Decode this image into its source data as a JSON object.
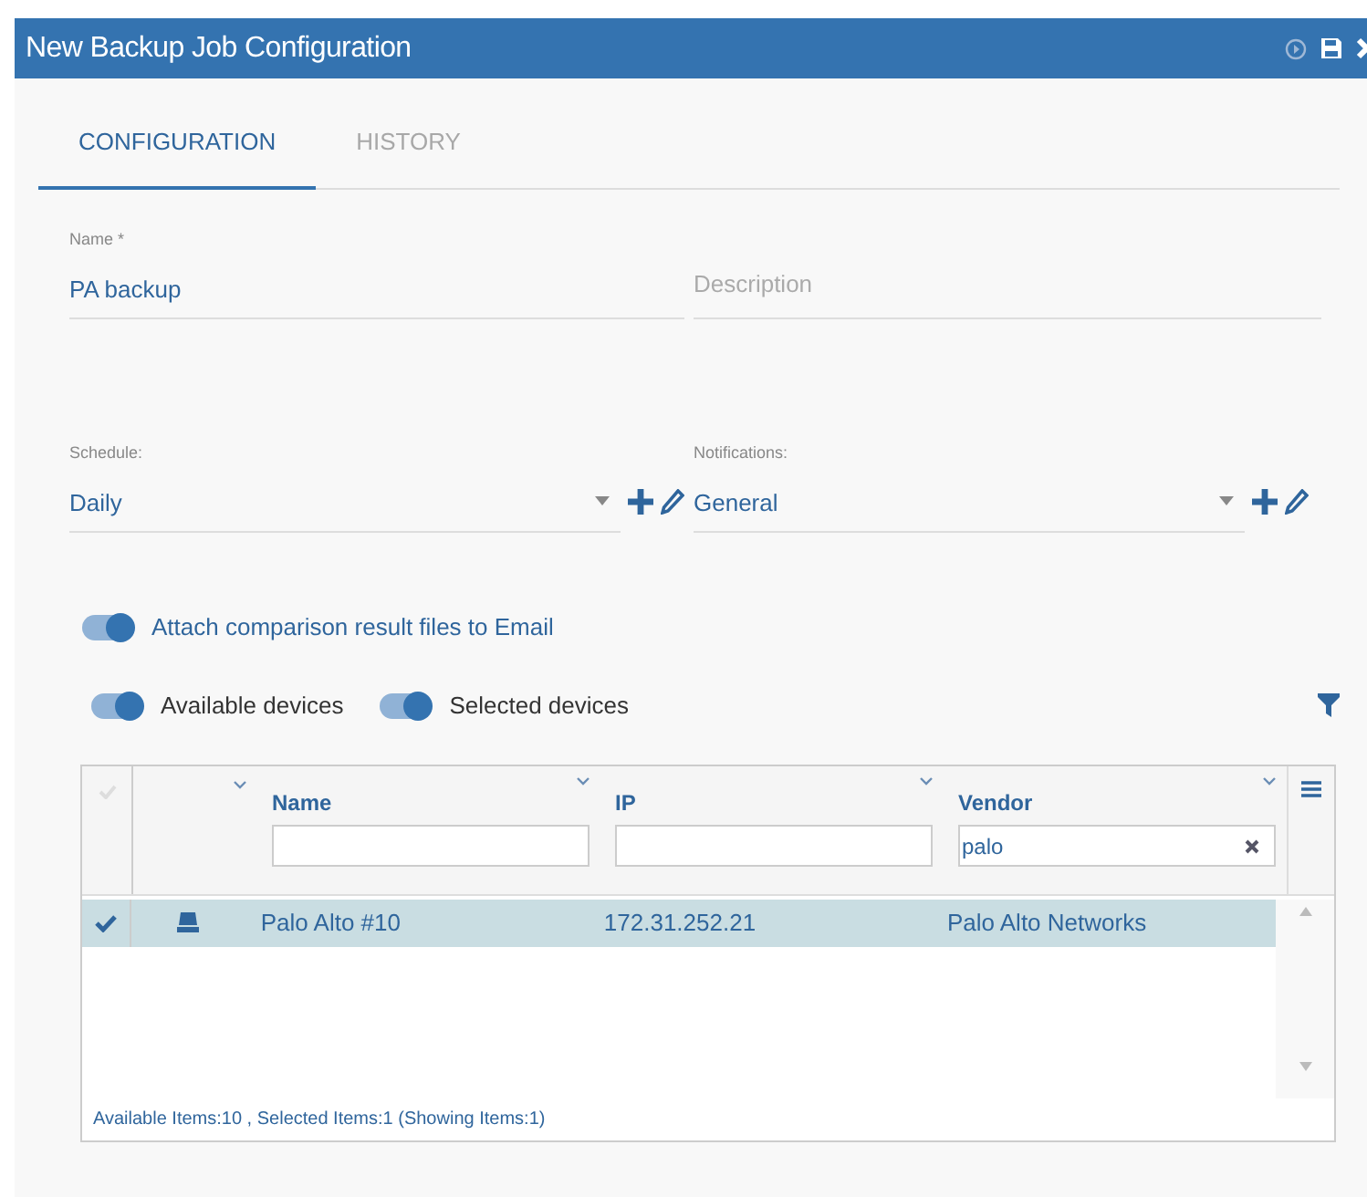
{
  "window": {
    "title": "New Backup Job Configuration"
  },
  "tabs": [
    {
      "label": "CONFIGURATION",
      "selected": true
    },
    {
      "label": "HISTORY",
      "selected": false
    }
  ],
  "name_field": {
    "label": "Name *",
    "value": "PA backup"
  },
  "description_field": {
    "placeholder": "Description"
  },
  "schedule": {
    "label": "Schedule:",
    "value": "Daily"
  },
  "notifications": {
    "label": "Notifications:",
    "value": "General"
  },
  "attach_toggle": {
    "label": "Attach comparison result files to Email",
    "on": true
  },
  "device_toggles": [
    {
      "label": "Available devices",
      "on": true
    },
    {
      "label": "Selected devices",
      "on": true
    }
  ],
  "table": {
    "columns": [
      {
        "label": "Name"
      },
      {
        "label": "IP"
      },
      {
        "label": "Vendor",
        "filter": "palo"
      }
    ],
    "rows": [
      {
        "selected": true,
        "name": "Palo Alto #10",
        "ip": "172.31.252.21",
        "vendor": "Palo Alto Networks"
      }
    ],
    "footer": "Available Items:10 , Selected Items:1 (Showing Items:1)"
  }
}
